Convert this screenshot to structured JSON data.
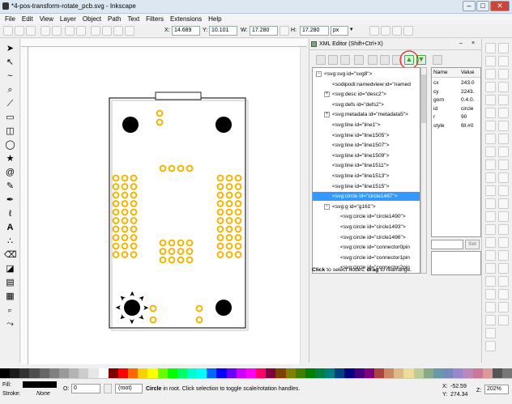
{
  "window": {
    "title": "*4-pos-transform-rotate_pcb.svg - Inkscape"
  },
  "menu": [
    "File",
    "Edit",
    "View",
    "Layer",
    "Object",
    "Path",
    "Text",
    "Filters",
    "Extensions",
    "Help"
  ],
  "controls": {
    "x_label": "X:",
    "x_value": "14.689",
    "y_label": "Y:",
    "y_value": "10.101",
    "w_label": "W:",
    "w_value": "17.280",
    "h_label": "H:",
    "h_value": "17.280",
    "unit": "px"
  },
  "xml_editor": {
    "title": "XML Editor (Shift+Ctrl+X)",
    "nodes": [
      {
        "label": "<svg:svg id=\"svg8\">",
        "level": 0,
        "expander": "minus"
      },
      {
        "label": "<sodipodi:namedview id=\"named",
        "level": 1,
        "expander": ""
      },
      {
        "label": "<svg:desc id=\"desc2\">",
        "level": 1,
        "expander": "plus"
      },
      {
        "label": "<svg:defs id=\"defs2\">",
        "level": 1,
        "expander": ""
      },
      {
        "label": "<svg:metadata id=\"metadata5\">",
        "level": 1,
        "expander": "plus"
      },
      {
        "label": "<svg:line id=\"line1\">",
        "level": 1,
        "expander": ""
      },
      {
        "label": "<svg:line id=\"line1505\">",
        "level": 1,
        "expander": ""
      },
      {
        "label": "<svg:line id=\"line1507\">",
        "level": 1,
        "expander": ""
      },
      {
        "label": "<svg:line id=\"line1509\">",
        "level": 1,
        "expander": ""
      },
      {
        "label": "<svg:line id=\"line1511\">",
        "level": 1,
        "expander": ""
      },
      {
        "label": "<svg:line id=\"line1513\">",
        "level": 1,
        "expander": ""
      },
      {
        "label": "<svg:line id=\"line1515\">",
        "level": 1,
        "expander": ""
      },
      {
        "label": "<svg:circle id=\"circle1487\">",
        "level": 1,
        "expander": "",
        "selected": true
      },
      {
        "label": "<svg:g id=\"g161\">",
        "level": 1,
        "expander": "minus"
      },
      {
        "label": "<svg:circle id=\"circle1490\">",
        "level": 2,
        "expander": ""
      },
      {
        "label": "<svg:circle id=\"circle1493\">",
        "level": 2,
        "expander": ""
      },
      {
        "label": "<svg:circle id=\"circle1496\">",
        "level": 2,
        "expander": ""
      },
      {
        "label": "<svg:circle id=\"connector0pin",
        "level": 2,
        "expander": ""
      },
      {
        "label": "<svg:circle id=\"connector1pin",
        "level": 2,
        "expander": ""
      },
      {
        "label": "<svg:circle id=\"connector2pin",
        "level": 2,
        "expander": ""
      }
    ],
    "attr_headers": [
      "Name",
      "Value"
    ],
    "attributes": [
      {
        "name": "cx",
        "value": "243.0"
      },
      {
        "name": "cy",
        "value": "2243."
      },
      {
        "name": "gorn",
        "value": "0.4.0."
      },
      {
        "name": "id",
        "value": "circle"
      },
      {
        "name": "r",
        "value": "90"
      },
      {
        "name": "style",
        "value": "fill:#0"
      }
    ],
    "set_button": "Set",
    "hint": "Click to select nodes, drag to rearrange."
  },
  "status": {
    "fill_label": "Fill:",
    "stroke_label": "Stroke:",
    "stroke_value": "None",
    "opacity_label": "O:",
    "opacity_value": "0",
    "layer": "(root)",
    "message_bold": "Circle",
    "message": " in root. Click selection to toggle scale/rotation handles.",
    "x_label": "X:",
    "x_value": "-52.59",
    "y_label": "Y:",
    "y_value": "274.34",
    "z_label": "Z:",
    "zoom": "202%"
  },
  "colors": {
    "pad": "#f5b400",
    "pcb_outline": "#222222",
    "selection": "#3399ff",
    "annotation": "#e02020"
  }
}
